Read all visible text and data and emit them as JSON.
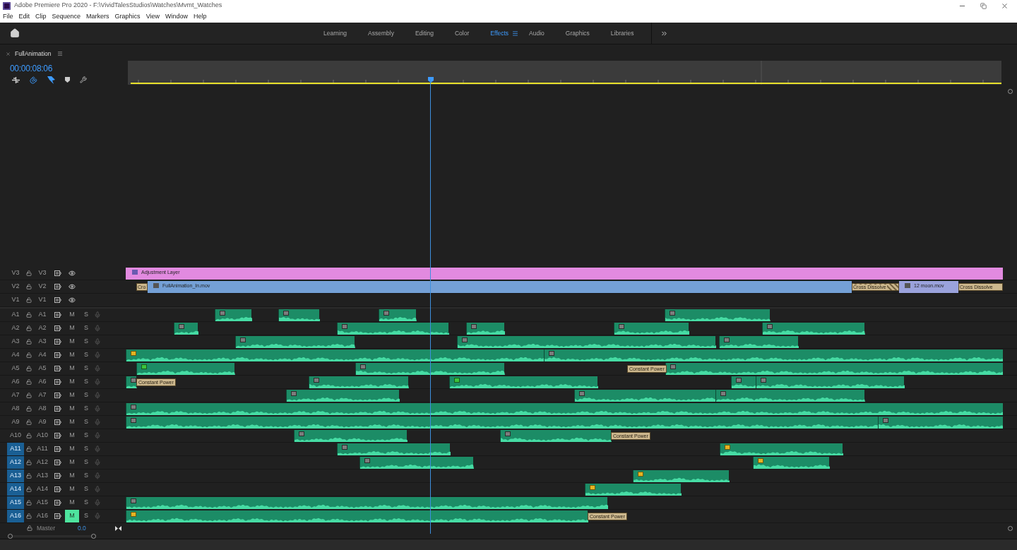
{
  "window": {
    "title": "Adobe Premiere Pro 2020 - F:\\VividTalesStudios\\Watches\\Mvmt_Watches"
  },
  "menu": [
    "File",
    "Edit",
    "Clip",
    "Sequence",
    "Markers",
    "Graphics",
    "View",
    "Window",
    "Help"
  ],
  "workspaces": [
    {
      "label": "Learning",
      "selected": false
    },
    {
      "label": "Assembly",
      "selected": false
    },
    {
      "label": "Editing",
      "selected": false
    },
    {
      "label": "Color",
      "selected": false
    },
    {
      "label": "Effects",
      "selected": true
    },
    {
      "label": "Audio",
      "selected": false
    },
    {
      "label": "Graphics",
      "selected": false
    },
    {
      "label": "Libraries",
      "selected": false
    }
  ],
  "sequence": {
    "tab": "FullAnimation",
    "timecode": "00:00:08:06"
  },
  "video_tracks": [
    {
      "name": "V3",
      "source": "V3",
      "clips": [
        {
          "kind": "adjustment",
          "label": "Adjustment Layer"
        }
      ]
    },
    {
      "name": "V2",
      "source": "V2",
      "clips": [
        {
          "kind": "transition",
          "label": "Cro"
        },
        {
          "kind": "video",
          "label": "FullAnimation_In.mov"
        },
        {
          "kind": "transition",
          "label": "Cross Dissolve"
        },
        {
          "kind": "video",
          "label": "12 moon.mov"
        },
        {
          "kind": "transition",
          "label": "Cross Dissolve"
        }
      ]
    },
    {
      "name": "V1",
      "source": "V1"
    }
  ],
  "audio_tracks": [
    {
      "name": "A1",
      "source": "A1",
      "mute": "M",
      "solo": "S",
      "targeted": false,
      "muted": false
    },
    {
      "name": "A2",
      "source": "A2",
      "mute": "M",
      "solo": "S",
      "targeted": false,
      "muted": false
    },
    {
      "name": "A3",
      "source": "A3",
      "mute": "M",
      "solo": "S",
      "targeted": false,
      "muted": false
    },
    {
      "name": "A4",
      "source": "A4",
      "mute": "M",
      "solo": "S",
      "targeted": false,
      "muted": false
    },
    {
      "name": "A5",
      "source": "A5",
      "mute": "M",
      "solo": "S",
      "targeted": false,
      "muted": false,
      "transitions": [
        "Constant Power"
      ]
    },
    {
      "name": "A6",
      "source": "A6",
      "mute": "M",
      "solo": "S",
      "targeted": false,
      "muted": false,
      "transitions": [
        "Constant Power"
      ]
    },
    {
      "name": "A7",
      "source": "A7",
      "mute": "M",
      "solo": "S",
      "targeted": false,
      "muted": false
    },
    {
      "name": "A8",
      "source": "A8",
      "mute": "M",
      "solo": "S",
      "targeted": false,
      "muted": false
    },
    {
      "name": "A9",
      "source": "A9",
      "mute": "M",
      "solo": "S",
      "targeted": false,
      "muted": false
    },
    {
      "name": "A10",
      "source": "A10",
      "mute": "M",
      "solo": "S",
      "targeted": false,
      "muted": false,
      "transitions": [
        "Constant Power"
      ]
    },
    {
      "name": "A11",
      "source": "A11",
      "mute": "M",
      "solo": "S",
      "targeted": true,
      "muted": false
    },
    {
      "name": "A12",
      "source": "A12",
      "mute": "M",
      "solo": "S",
      "targeted": true,
      "muted": false
    },
    {
      "name": "A13",
      "source": "A13",
      "mute": "M",
      "solo": "S",
      "targeted": true,
      "muted": false
    },
    {
      "name": "A14",
      "source": "A14",
      "mute": "M",
      "solo": "S",
      "targeted": true,
      "muted": false
    },
    {
      "name": "A15",
      "source": "A15",
      "mute": "M",
      "solo": "S",
      "targeted": true,
      "muted": false
    },
    {
      "name": "A16",
      "source": "A16",
      "mute": "M",
      "solo": "S",
      "targeted": true,
      "muted": true,
      "transitions": [
        "Constant Power"
      ]
    }
  ],
  "master": {
    "label": "Master",
    "value": "0.0"
  }
}
